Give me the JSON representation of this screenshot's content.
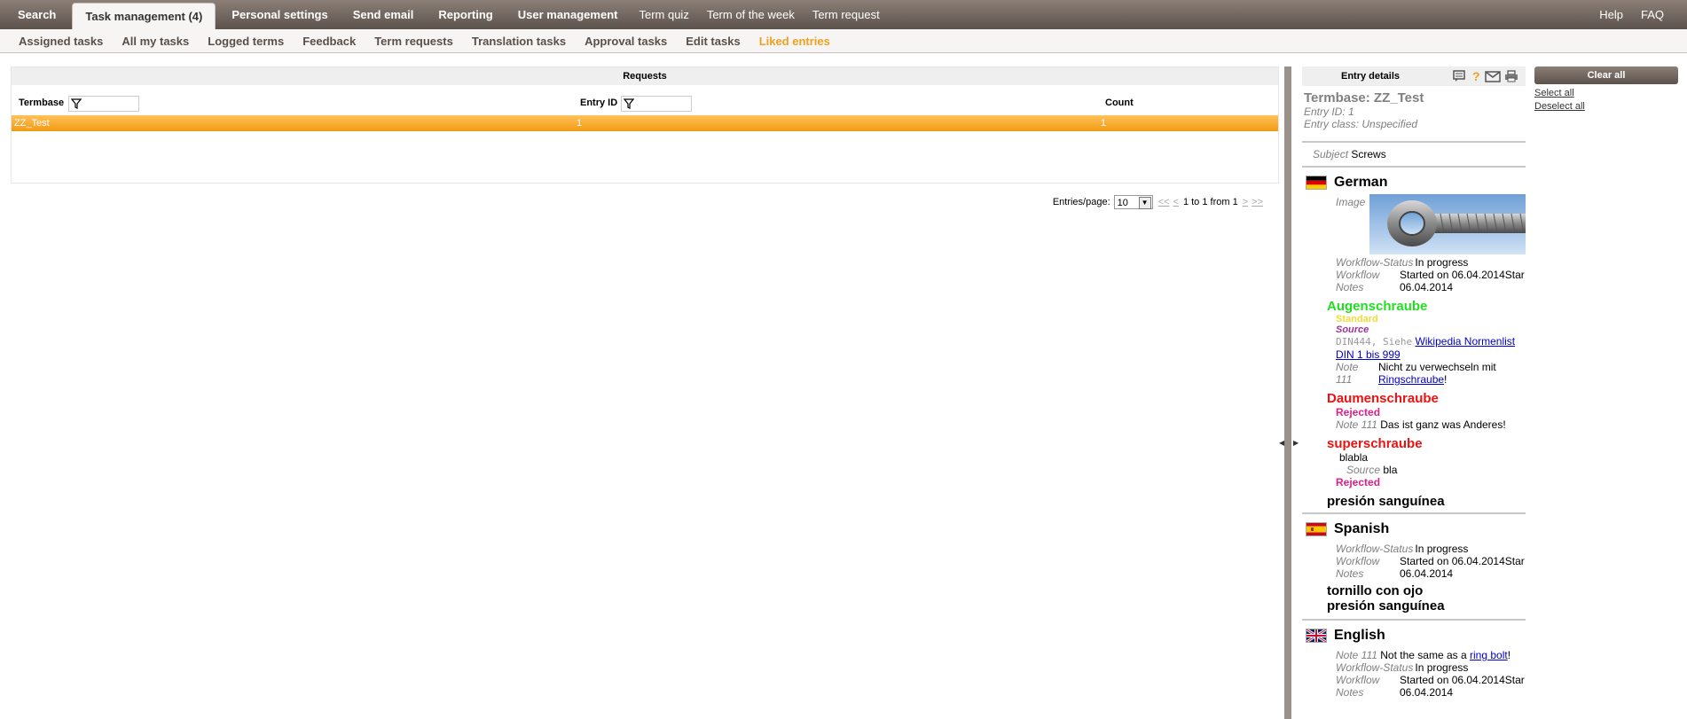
{
  "topnav": {
    "tabs": [
      "Search",
      "Task management (4)",
      "Personal settings",
      "Send email",
      "Reporting",
      "User management"
    ],
    "plain": [
      "Term quiz",
      "Term of the week",
      "Term request"
    ],
    "right": [
      "Help",
      "FAQ"
    ]
  },
  "subnav": [
    "Assigned tasks",
    "All my tasks",
    "Logged terms",
    "Feedback",
    "Term requests",
    "Translation tasks",
    "Approval tasks",
    "Edit tasks",
    "Liked entries"
  ],
  "requests": {
    "title": "Requests",
    "columns": [
      "Termbase",
      "Entry ID",
      "Count"
    ],
    "row": {
      "termbase": "ZZ_Test",
      "entry_id": "1",
      "count": "1"
    }
  },
  "pager": {
    "label": "Entries/page:",
    "per_page": "10",
    "first": "<<",
    "prev": "<",
    "info": "1 to 1 from 1",
    "next": ">",
    "last": ">>"
  },
  "details": {
    "title": "Entry details",
    "termbase": "Termbase: ZZ_Test",
    "entry_id": "Entry ID: 1",
    "entry_class": "Entry class: Unspecified",
    "subject_label": "Subject",
    "subject": "Screws",
    "german": {
      "name": "German",
      "image_label": "Image",
      "ws_label": "Workflow-Status",
      "ws": "In progress",
      "wf_label": "Workflow",
      "wf": "Started on 06.04.2014Star",
      "notes_label": "Notes",
      "notes": "06.04.2014",
      "t1": "Augenschraube",
      "t1_status": "Standard",
      "t1_src_label": "Source",
      "t1_src_text": "DIN444, Siehe",
      "t1_src_link1": "Wikipedia Normenlist",
      "t1_src_link2": "DIN 1 bis 999",
      "t1_note_label": "Note",
      "t1_note_num": "111",
      "t1_note": "Nicht zu verwechseln mit",
      "t1_note_link": "Ringschraube",
      "t1_note_end": "!",
      "t2": "Daumenschraube",
      "t2_status": "Rejected",
      "t2_note_label": "Note 111",
      "t2_note": "Das ist ganz was Anderes!",
      "t3": "superschraube",
      "t3_text": "blabla",
      "t3_src_label": "Source",
      "t3_src": "bla",
      "t3_status": "Rejected",
      "t4": "presión sanguínea"
    },
    "spanish": {
      "name": "Spanish",
      "ws_label": "Workflow-Status",
      "ws": "In progress",
      "wf_label": "Workflow",
      "wf": "Started on 06.04.2014Star",
      "notes_label": "Notes",
      "notes": "06.04.2014",
      "t1": "tornillo con ojo",
      "t2": "presión sanguínea"
    },
    "english": {
      "name": "English",
      "note_label": "Note 111",
      "note": "Not the same as a",
      "note_link": "ring bolt",
      "note_end": "!",
      "ws_label": "Workflow-Status",
      "ws": "In progress",
      "wf_label": "Workflow",
      "wf": "Started on 06.04.2014Star",
      "notes_label": "Notes",
      "notes": "06.04.2014"
    }
  },
  "actions": {
    "clear_all": "Clear all",
    "select_all": "Select all",
    "deselect_all": "Deselect all"
  },
  "colors": {
    "accent": "#f0a020",
    "nav": "#6f645d"
  }
}
